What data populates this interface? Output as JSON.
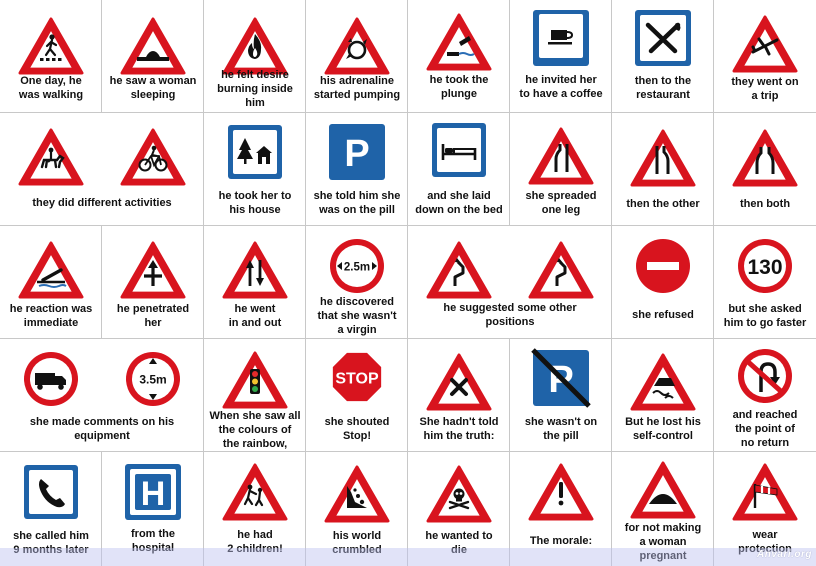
{
  "colors": {
    "red": "#d8141e",
    "blue": "#1f63a8",
    "black": "#111111",
    "white": "#ffffff",
    "grid": "#c8c8c8"
  },
  "watermark": "Anvari.org",
  "cells": [
    {
      "id": "walking",
      "icon": "pedestrian-crossing-icon",
      "caption": "One day, he\nwas walking"
    },
    {
      "id": "sleeping",
      "icon": "speed-bump-icon",
      "caption": "he saw a woman\nsleeping"
    },
    {
      "id": "desire",
      "icon": "flammable-icon",
      "caption": "he felt desire\nburning inside\nhim"
    },
    {
      "id": "adrenaline",
      "icon": "roundabout-icon",
      "caption": "his adrenaline\nstarted pumping"
    },
    {
      "id": "plunge",
      "icon": "quayside-icon",
      "caption": "he took the\nplunge"
    },
    {
      "id": "coffee",
      "icon": "coffee-cup-icon",
      "caption": "he invited her\nto have a coffee"
    },
    {
      "id": "restaurant",
      "icon": "fork-knife-icon",
      "caption": "then to the\nrestaurant"
    },
    {
      "id": "trip",
      "icon": "airplane-icon",
      "caption": "they went on\na trip"
    },
    {
      "id": "activities",
      "icon": "horse-rider-bicycle-icon",
      "caption": "they did different activities"
    },
    {
      "id": "house",
      "icon": "forest-house-icon",
      "caption": "he took her to\nhis house"
    },
    {
      "id": "pill",
      "icon": "parking-icon",
      "caption": "she told him she\nwas on the pill"
    },
    {
      "id": "bed",
      "icon": "bed-icon",
      "caption": "and she laid\ndown on the bed"
    },
    {
      "id": "one-leg",
      "icon": "road-narrows-left-icon",
      "caption": "she spreaded\none leg"
    },
    {
      "id": "other",
      "icon": "road-narrows-right-icon",
      "caption": "then the other"
    },
    {
      "id": "both",
      "icon": "road-narrows-both-icon",
      "caption": "then both"
    },
    {
      "id": "reaction",
      "icon": "drawbridge-icon",
      "caption": "he reaction was\nimmediate"
    },
    {
      "id": "penetrated",
      "icon": "crossroad-icon",
      "caption": "he penetrated\nher"
    },
    {
      "id": "in-out",
      "icon": "two-way-traffic-icon",
      "caption": "he went\nin and out"
    },
    {
      "id": "virgin",
      "icon": "width-limit-icon",
      "sign_text": "2.5m",
      "caption": "he discovered\nthat she wasn't\na virgin"
    },
    {
      "id": "positions",
      "icon": "double-bend-icon",
      "caption": "he suggested some other\npositions"
    },
    {
      "id": "refused",
      "icon": "no-entry-icon",
      "caption": "she refused"
    },
    {
      "id": "faster",
      "icon": "speed-limit-icon",
      "sign_text": "130",
      "caption": "but she asked\nhim to go faster"
    },
    {
      "id": "comments",
      "icon": "no-trucks-height-limit-icon",
      "sign_text": "3.5m",
      "caption": "she made comments on his\nequipment"
    },
    {
      "id": "rainbow",
      "icon": "traffic-light-icon",
      "caption": "When she saw all\nthe colours of\nthe rainbow,"
    },
    {
      "id": "stop",
      "icon": "stop-icon",
      "sign_text": "STOP",
      "caption": "she shouted\nStop!"
    },
    {
      "id": "truth",
      "icon": "priority-crossroad-icon",
      "caption": "She hadn't told\nhim the truth:"
    },
    {
      "id": "not-on-pill",
      "icon": "no-parking-icon",
      "caption": "she wasn't on\nthe pill"
    },
    {
      "id": "self-control",
      "icon": "slippery-road-icon",
      "caption": "But he lost his\nself-control"
    },
    {
      "id": "no-return",
      "icon": "no-u-turn-icon",
      "caption": "and reached\nthe point of\nno return"
    },
    {
      "id": "called",
      "icon": "telephone-icon",
      "caption": "she called him\n9 months later"
    },
    {
      "id": "hospital",
      "icon": "hospital-icon",
      "sign_text": "H",
      "caption": "from the\nhospital"
    },
    {
      "id": "children",
      "icon": "children-icon",
      "caption": "he had\n2 children!"
    },
    {
      "id": "crumbled",
      "icon": "falling-rocks-icon",
      "caption": "his world\ncrumbled"
    },
    {
      "id": "die",
      "icon": "skull-icon",
      "caption": "he wanted to\ndie"
    },
    {
      "id": "morale",
      "icon": "exclamation-icon",
      "caption": "The morale:"
    },
    {
      "id": "pregnant",
      "icon": "hump-icon",
      "caption": "for not making\na woman\npregnant"
    },
    {
      "id": "protection",
      "icon": "windsock-icon",
      "caption": "wear\nprotection"
    }
  ]
}
